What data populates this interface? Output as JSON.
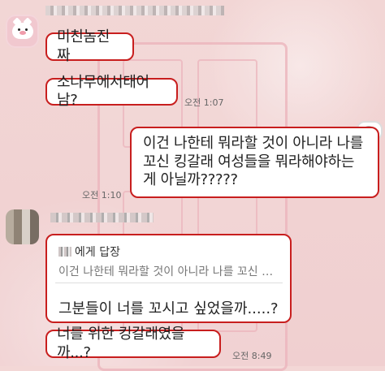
{
  "messages": {
    "m1": "미친놈진짜",
    "m2": "소나무에서태어남?",
    "m3": "이건 나한테 뭐라할 것이 아니라 나를\n꼬신 킹갈래 여성들을 뭐라해야하는\n게 아닐까?????",
    "reply_label": "에게 답장",
    "reply_quote": "이건 나한테 뭐라할 것이 아니라 나를 꼬신 킹...",
    "reply_text": "그분들이 너를 꼬시고 싶었을까.....?",
    "m5": "너를 위한 킹갈래였을까...?"
  },
  "timestamps": {
    "t1": "오전 1:07",
    "t2": "오전 1:10",
    "t3": "오전 8:49"
  },
  "icons": {
    "main_avatar": "pig-avatar-icon",
    "sticker": "sticker-face-icon",
    "other_avatar": "blurred-avatar"
  },
  "colors": {
    "bubble_border": "#c81e1e",
    "background": "#f3d7d6"
  }
}
